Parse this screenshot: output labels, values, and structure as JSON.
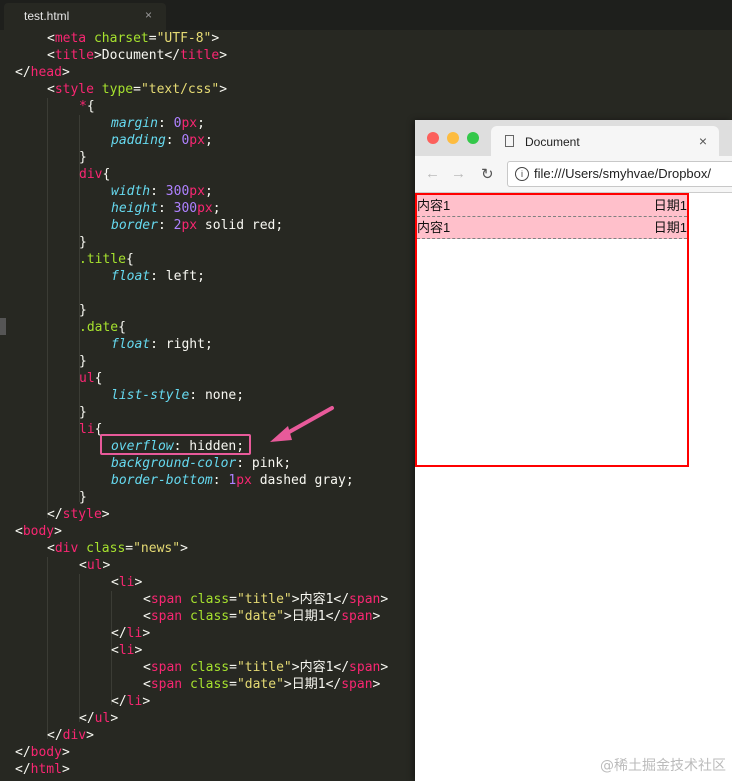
{
  "editor": {
    "tab_label": "test.html",
    "tab_close": "×"
  },
  "code": {
    "l1": {
      "open": "<",
      "tag": "meta",
      "attr": " charset",
      "eq": "=",
      "val": "\"UTF-8\"",
      "close": ">"
    },
    "l2": {
      "open": "<",
      "tag": "title",
      "text": "Document",
      "end": "</",
      "tag2": "title",
      "close": ">"
    },
    "l3": {
      "open": "</",
      "tag": "head",
      "close": ">"
    },
    "l4": {
      "open": "<",
      "tag": "style",
      "attr": " type",
      "eq": "=",
      "val": "\"text/css\"",
      "close": ">"
    },
    "l5": {
      "sel": "*",
      "brace": "{"
    },
    "l6": {
      "prop": "margin",
      "colon": ": ",
      "num": "0",
      "unit": "px",
      "semi": ";"
    },
    "l7": {
      "prop": "padding",
      "colon": ": ",
      "num": "0",
      "unit": "px",
      "semi": ";"
    },
    "l8": {
      "brace": "}"
    },
    "l9": {
      "sel": "div",
      "brace": "{"
    },
    "l10": {
      "prop": "width",
      "colon": ": ",
      "num": "300",
      "unit": "px",
      "semi": ";"
    },
    "l11": {
      "prop": "height",
      "colon": ": ",
      "num": "300",
      "unit": "px",
      "semi": ";"
    },
    "l12": {
      "prop": "border",
      "colon": ": ",
      "num": "2",
      "unit": "px",
      "rest": " solid red",
      "semi": ";"
    },
    "l13": {
      "brace": "}"
    },
    "l14": {
      "sel": ".title",
      "brace": "{"
    },
    "l15": {
      "prop": "float",
      "colon": ": ",
      "val": "left",
      "semi": ";"
    },
    "l17": {
      "brace": "}"
    },
    "l18": {
      "sel": ".date",
      "brace": "{"
    },
    "l19": {
      "prop": "float",
      "colon": ": ",
      "val": "right",
      "semi": ";"
    },
    "l20": {
      "brace": "}"
    },
    "l21": {
      "sel": "ul",
      "brace": "{"
    },
    "l22": {
      "prop": "list-style",
      "colon": ": ",
      "val": "none",
      "semi": ";"
    },
    "l23": {
      "brace": "}"
    },
    "l24": {
      "sel": "li",
      "brace": "{"
    },
    "l25": {
      "prop": "overflow",
      "colon": ": ",
      "val": "hidden",
      "semi": ";"
    },
    "l26": {
      "prop": "background-color",
      "colon": ": ",
      "val": "pink",
      "semi": ";"
    },
    "l27": {
      "prop": "border-bottom",
      "colon": ": ",
      "num": "1",
      "unit": "px",
      "rest": " dashed gray",
      "semi": ";"
    },
    "l28": {
      "brace": "}"
    },
    "l29": {
      "open": "</",
      "tag": "style",
      "close": ">"
    },
    "l30": {
      "open": "<",
      "tag": "body",
      "close": ">"
    },
    "l31": {
      "open": "<",
      "tag": "div",
      "attr": " class",
      "eq": "=",
      "val": "\"news\"",
      "close": ">"
    },
    "l32": {
      "open": "<",
      "tag": "ul",
      "close": ">"
    },
    "l33": {
      "open": "<",
      "tag": "li",
      "close": ">"
    },
    "l34": {
      "open": "<",
      "tag": "span",
      "attr": " class",
      "eq": "=",
      "val": "\"title\"",
      "close": ">",
      "text": "内容1",
      "end": "</",
      "tag2": "span",
      "close2": ">"
    },
    "l35": {
      "open": "<",
      "tag": "span",
      "attr": " class",
      "eq": "=",
      "val": "\"date\"",
      "close": ">",
      "text": "日期1",
      "end": "</",
      "tag2": "span",
      "close2": ">"
    },
    "l36": {
      "open": "</",
      "tag": "li",
      "close": ">"
    },
    "l37": {
      "open": "<",
      "tag": "li",
      "close": ">"
    },
    "l38": {
      "open": "<",
      "tag": "span",
      "attr": " class",
      "eq": "=",
      "val": "\"title\"",
      "close": ">",
      "text": "内容1",
      "end": "</",
      "tag2": "span",
      "close2": ">"
    },
    "l39": {
      "open": "<",
      "tag": "span",
      "attr": " class",
      "eq": "=",
      "val": "\"date\"",
      "close": ">",
      "text": "日期1",
      "end": "</",
      "tag2": "span",
      "close2": ">"
    },
    "l40": {
      "open": "</",
      "tag": "li",
      "close": ">"
    },
    "l41": {
      "open": "</",
      "tag": "ul",
      "close": ">"
    },
    "l42": {
      "open": "</",
      "tag": "div",
      "close": ">"
    },
    "l43": {
      "open": "</",
      "tag": "body",
      "close": ">"
    },
    "l44": {
      "open": "</",
      "tag": "html",
      "close": ">"
    }
  },
  "browser": {
    "tab_title": "Document",
    "tab_close": "×",
    "back": "←",
    "forward": "→",
    "reload": "↻",
    "info": "i",
    "url": "file:///Users/smyhvae/Dropbox/",
    "items": [
      {
        "title": "内容1",
        "date": "日期1"
      },
      {
        "title": "内容1",
        "date": "日期1"
      }
    ]
  },
  "colors": {
    "editor_bg": "#272822",
    "highlight_border": "#e85a9a",
    "arrow": "#e85a9a",
    "news_border": "#ff0000",
    "li_bg": "#ffc0cb"
  },
  "watermark": "@稀土掘金技术社区"
}
